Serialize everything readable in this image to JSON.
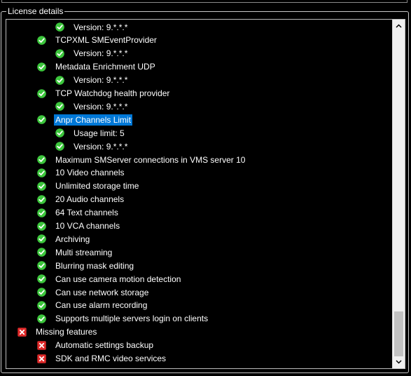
{
  "group_title": "License details",
  "rows": [
    {
      "label": "Version: 9.*.*.*",
      "status": "ok",
      "level": 2
    },
    {
      "label": "TCPXML SMEventProvider",
      "status": "ok",
      "level": 1
    },
    {
      "label": "Version: 9.*.*.*",
      "status": "ok",
      "level": 2
    },
    {
      "label": "Metadata Enrichment UDP",
      "status": "ok",
      "level": 1
    },
    {
      "label": "Version: 9.*.*.*",
      "status": "ok",
      "level": 2
    },
    {
      "label": "TCP Watchdog health provider",
      "status": "ok",
      "level": 1
    },
    {
      "label": "Version: 9.*.*.*",
      "status": "ok",
      "level": 2
    },
    {
      "label": "Anpr Channels Limit",
      "status": "ok",
      "level": 1,
      "selected": true
    },
    {
      "label": "Usage limit: 5",
      "status": "ok",
      "level": 2
    },
    {
      "label": "Version: 9.*.*.*",
      "status": "ok",
      "level": 2
    },
    {
      "label": "Maximum SMServer connections in VMS server 10",
      "status": "ok",
      "level": 1
    },
    {
      "label": "10 Video channels",
      "status": "ok",
      "level": 1
    },
    {
      "label": "Unlimited storage time",
      "status": "ok",
      "level": 1
    },
    {
      "label": "20 Audio channels",
      "status": "ok",
      "level": 1
    },
    {
      "label": "64 Text channels",
      "status": "ok",
      "level": 1
    },
    {
      "label": "10 VCA channels",
      "status": "ok",
      "level": 1
    },
    {
      "label": "Archiving",
      "status": "ok",
      "level": 1
    },
    {
      "label": "Multi streaming",
      "status": "ok",
      "level": 1
    },
    {
      "label": "Blurring mask editing",
      "status": "ok",
      "level": 1
    },
    {
      "label": "Can use camera motion detection",
      "status": "ok",
      "level": 1
    },
    {
      "label": "Can use network storage",
      "status": "ok",
      "level": 1
    },
    {
      "label": "Can use alarm recording",
      "status": "ok",
      "level": 1
    },
    {
      "label": "Supports multiple servers login on clients",
      "status": "ok",
      "level": 1
    },
    {
      "label": "Missing features",
      "status": "missing",
      "level": 0
    },
    {
      "label": "Automatic settings backup",
      "status": "missing",
      "level": 1
    },
    {
      "label": "SDK and RMC video services",
      "status": "missing",
      "level": 1
    }
  ],
  "icons": {
    "ok": "check-circle-icon",
    "missing": "x-square-icon"
  },
  "colors": {
    "ok": "#3cc63c",
    "missing": "#e02a2a",
    "selection": "#0078d7"
  },
  "scrollbar": {
    "position": 0.87,
    "visible_fraction": 0.13
  }
}
